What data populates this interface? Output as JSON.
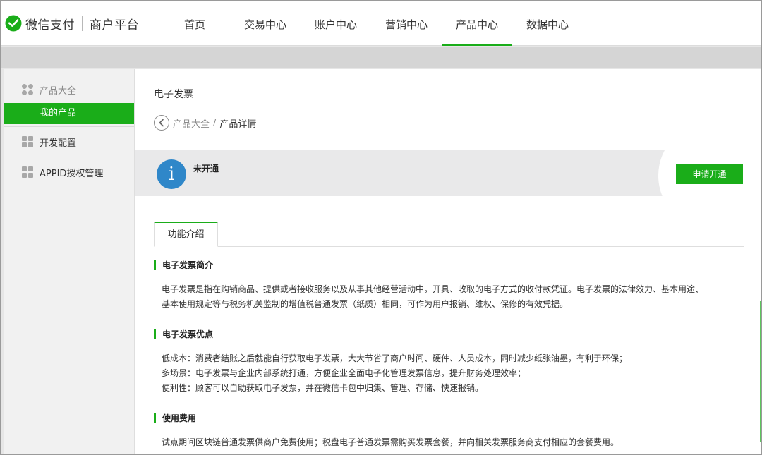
{
  "brand": {
    "name": "微信支付",
    "platform": "商户平台"
  },
  "nav": {
    "items": [
      {
        "label": "首页"
      },
      {
        "label": "交易中心"
      },
      {
        "label": "账户中心"
      },
      {
        "label": "营销中心"
      },
      {
        "label": "产品中心"
      },
      {
        "label": "数据中心"
      }
    ],
    "active": "产品中心"
  },
  "sidebar": {
    "products_label": "产品大全",
    "my_products_label": "我的产品",
    "dev_config_label": "开发配置",
    "appid_label": "APPID授权管理"
  },
  "main": {
    "title": "电子发票",
    "breadcrumb": {
      "parent": "产品大全",
      "separator": "/",
      "current": "产品详情"
    },
    "status": {
      "text": "未开通",
      "action_label": "申请开通"
    },
    "tab_label": "功能介绍",
    "sections": [
      {
        "title": "电子发票简介",
        "lines": [
          "电子发票是指在购销商品、提供或者接收服务以及从事其他经营活动中，开具、收取的电子方式的收付款凭证。电子发票的法律效力、基本用途、",
          "基本使用规定等与税务机关监制的增值税普通发票（纸质）相同，可作为用户报销、维权、保修的有效凭据。"
        ]
      },
      {
        "title": "电子发票优点",
        "lines": [
          "低成本：消费者结账之后就能自行获取电子发票，大大节省了商户时间、硬件、人员成本，同时减少纸张油墨，有利于环保；",
          "多场景：电子发票与企业内部系统打通，方便企业全面电子化管理发票信息，提升财务处理效率；",
          "便利性：顾客可以自助获取电子发票，并在微信卡包中归集、管理、存储、快速报销。"
        ]
      },
      {
        "title": "使用费用",
        "lines": [
          "试点期间区块链普通发票供商户免费使用；税盘电子普通发票需购买发票套餐，并向相关发票服务商支付相应的套餐费用。"
        ]
      }
    ]
  },
  "colors": {
    "accent": "#1aad19",
    "info": "#2f87c9"
  }
}
